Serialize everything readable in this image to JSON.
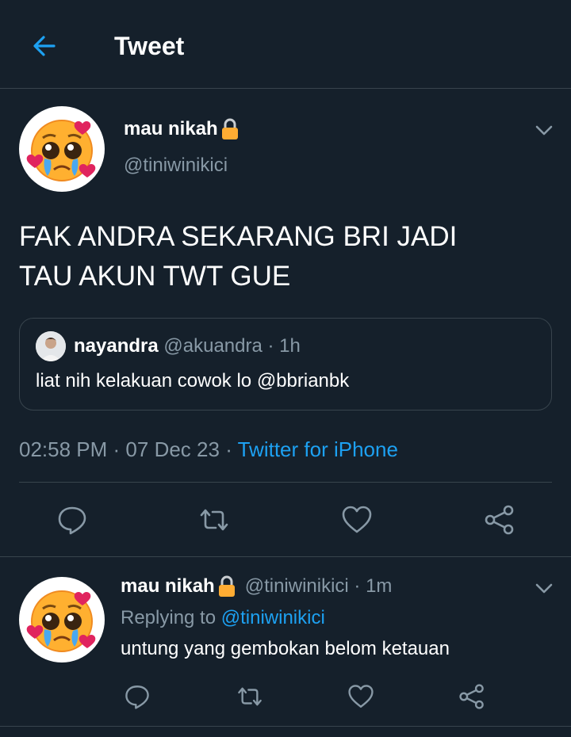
{
  "header": {
    "title": "Tweet",
    "back_icon": "arrow-left-icon"
  },
  "tweet": {
    "author_name": "mau nikah",
    "author_handle": "@tiniwinikici",
    "text_line1": "FAK ANDRA SEKARANG BRI JADI",
    "text_line2": "TAU AKUN TWT GUE",
    "quote": {
      "name": "nayandra",
      "handle_time": "@akuandra · 1h",
      "text": "liat nih kelakuan cowok lo @bbrianbk"
    },
    "time": "02:58 PM",
    "date": "07 Dec 23",
    "source": "Twitter for iPhone",
    "actions": [
      "reply-icon",
      "retweet-icon",
      "like-icon",
      "share-icon"
    ]
  },
  "reply": {
    "author_name": "mau nikah",
    "handle_time": "@tiniwinikici · 1m",
    "replying_prefix": "Replying to",
    "replying_to": "@tiniwinikici",
    "text": "untung yang gembokan belom ketauan"
  },
  "colors": {
    "background": "#15202b",
    "accent": "#1da1f2",
    "muted": "#8899a6",
    "border": "#38444d"
  }
}
